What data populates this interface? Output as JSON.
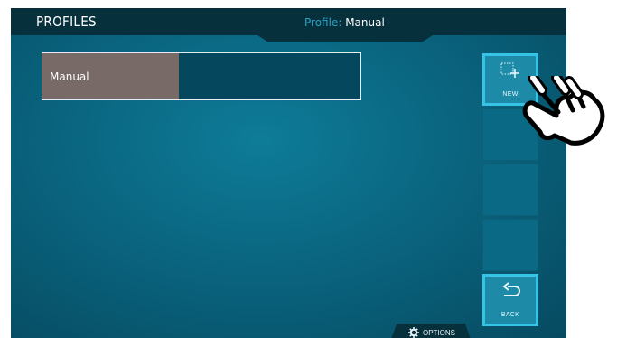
{
  "header": {
    "title": "PROFILES",
    "profile_label": "Profile:",
    "profile_value": "Manual"
  },
  "profiles": [
    {
      "name": "Manual",
      "level": 0.43
    }
  ],
  "side_buttons": {
    "new_label": "NEW",
    "back_label": "BACK"
  },
  "footer": {
    "options_label": "OPTIONS"
  },
  "icons": {
    "new": "new-profile-icon",
    "back": "back-arrow-icon",
    "options": "gear-icon",
    "pointer": "pointing-hand-icon"
  },
  "colors": {
    "accent": "#36c4e6",
    "background": "#0a6a85",
    "header": "#07303d",
    "profile_fill": "#786a66"
  }
}
